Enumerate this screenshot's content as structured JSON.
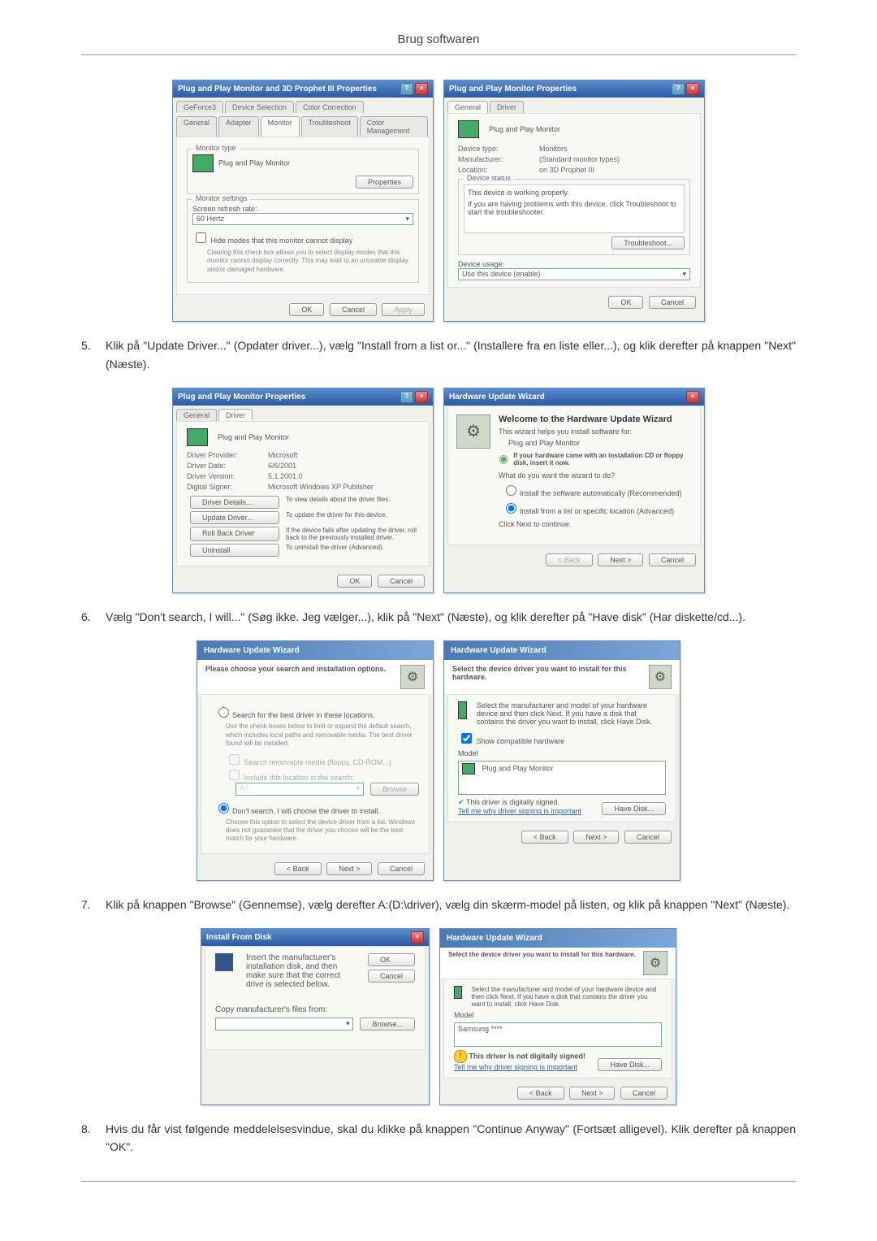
{
  "header": {
    "title": "Brug softwaren"
  },
  "dialogs1": {
    "left": {
      "title": "Plug and Play Monitor and 3D Prophet III Properties",
      "tabs_row1": [
        "GeForce3",
        "Device Selection",
        "Color Correction"
      ],
      "tabs_row2": [
        "General",
        "Adapter",
        "Monitor",
        "Troubleshoot",
        "Color Management"
      ],
      "g1": "Monitor type",
      "g1_text": "Plug and Play Monitor",
      "g1_btn": "Properties",
      "g2": "Monitor settings",
      "g2_label": "Screen refresh rate:",
      "g2_value": "60 Hertz",
      "g2_check": "Hide modes that this monitor cannot display",
      "g2_note": "Clearing this check box allows you to select display modes that this monitor cannot display correctly. This may lead to an unusable display and/or damaged hardware.",
      "btns": [
        "OK",
        "Cancel",
        "Apply"
      ]
    },
    "right": {
      "title": "Plug and Play Monitor Properties",
      "tabs": [
        "General",
        "Driver"
      ],
      "body_text": "Plug and Play Monitor",
      "rows": [
        {
          "l": "Device type:",
          "v": "Monitors"
        },
        {
          "l": "Manufacturer:",
          "v": "(Standard monitor types)"
        },
        {
          "l": "Location:",
          "v": "on 3D Prophet III"
        }
      ],
      "g_status": "Device status",
      "g_status_text1": "This device is working properly.",
      "g_status_text2": "If you are having problems with this device, click Troubleshoot to start the troubleshooter.",
      "g_status_btn": "Troubleshoot...",
      "usage_label": "Device usage:",
      "usage_value": "Use this device (enable)",
      "btns": [
        "OK",
        "Cancel"
      ]
    }
  },
  "steps": {
    "s5": {
      "num": "5.",
      "text": "Klik på \"Update Driver...\" (Opdater driver...), vælg \"Install from a list or...\" (Installere fra en liste eller...), og klik derefter på knappen \"Next\" (Næste)."
    },
    "s6": {
      "num": "6.",
      "text": "Vælg \"Don't search, I will...\" (Søg ikke. Jeg vælger...), klik på \"Next\" (Næste), og klik derefter på \"Have disk\" (Har diskette/cd...)."
    },
    "s7": {
      "num": "7.",
      "text": "Klik på knappen \"Browse\" (Gennemse), vælg derefter A:(D:\\driver), vælg din skærm-model på listen, og klik på knappen \"Next\" (Næste)."
    },
    "s8": {
      "num": "8.",
      "text": "Hvis du får vist følgende meddelelsesvindue, skal du klikke på knappen \"Continue Anyway\" (Fortsæt alligevel). Klik derefter på knappen \"OK\"."
    }
  },
  "dialogs2": {
    "left": {
      "title": "Plug and Play Monitor Properties",
      "tabs": [
        "General",
        "Driver"
      ],
      "body_text": "Plug and Play Monitor",
      "rows": [
        {
          "l": "Driver Provider:",
          "v": "Microsoft"
        },
        {
          "l": "Driver Date:",
          "v": "6/6/2001"
        },
        {
          "l": "Driver Version:",
          "v": "5.1.2001.0"
        },
        {
          "l": "Digital Signer:",
          "v": "Microsoft Windows XP Publisher"
        }
      ],
      "btns_col": [
        {
          "b": "Driver Details...",
          "t": "To view details about the driver files."
        },
        {
          "b": "Update Driver...",
          "t": "To update the driver for this device."
        },
        {
          "b": "Roll Back Driver",
          "t": "If the device fails after updating the driver, roll back to the previously installed driver."
        },
        {
          "b": "Uninstall",
          "t": "To uninstall the driver (Advanced)."
        }
      ],
      "btns": [
        "OK",
        "Cancel"
      ]
    },
    "right": {
      "title": "Hardware Update Wizard",
      "heading": "Welcome to the Hardware Update Wizard",
      "sub": "This wizard helps you install software for:",
      "device": "Plug and Play Monitor",
      "hint": "If your hardware came with an installation CD or floppy disk, insert it now.",
      "q": "What do you want the wizard to do?",
      "opt1": "Install the software automatically (Recommended)",
      "opt2": "Install from a list or specific location (Advanced)",
      "cont": "Click Next to continue.",
      "btns": [
        "< Back",
        "Next >",
        "Cancel"
      ]
    }
  },
  "dialogs3": {
    "left": {
      "title": "Hardware Update Wizard",
      "header": "Please choose your search and installation options.",
      "opt1": "Search for the best driver in these locations.",
      "opt1_sub": "Use the check boxes below to limit or expand the default search, which includes local paths and removable media. The best driver found will be installed.",
      "chk1": "Search removable media (floppy, CD-ROM...)",
      "chk2": "Include this location in the search:",
      "browse": "Browse",
      "opt2": "Don't search. I will choose the driver to install.",
      "opt2_sub": "Choose this option to select the device driver from a list. Windows does not guarantee that the driver you choose will be the best match for your hardware.",
      "btns": [
        "< Back",
        "Next >",
        "Cancel"
      ]
    },
    "right": {
      "title": "Hardware Update Wizard",
      "header": "Select the device driver you want to install for this hardware.",
      "sub": "Select the manufacturer and model of your hardware device and then click Next. If you have a disk that contains the driver you want to install, click Have Disk.",
      "chk": "Show compatible hardware",
      "model_label": "Model",
      "model_item": "Plug and Play Monitor",
      "signed": "This driver is digitally signed.",
      "tell": "Tell me why driver signing is important",
      "have_disk": "Have Disk...",
      "btns": [
        "< Back",
        "Next >",
        "Cancel"
      ]
    }
  },
  "dialogs4": {
    "left": {
      "title": "Install From Disk",
      "text": "Insert the manufacturer's installation disk, and then make sure that the correct drive is selected below.",
      "ok": "OK",
      "cancel": "Cancel",
      "copy_label": "Copy manufacturer's files from:",
      "browse": "Browse..."
    },
    "right": {
      "title": "Hardware Update Wizard",
      "header": "Select the device driver you want to install for this hardware.",
      "sub": "Select the manufacturer and model of your hardware device and then click Next. If you have a disk that contains the driver you want to install, click Have Disk.",
      "model_label": "Model",
      "model_item": "Samsung ****",
      "signed": "This driver is not digitally signed!",
      "tell": "Tell me why driver signing is important",
      "have_disk": "Have Disk...",
      "btns": [
        "< Back",
        "Next >",
        "Cancel"
      ]
    }
  }
}
